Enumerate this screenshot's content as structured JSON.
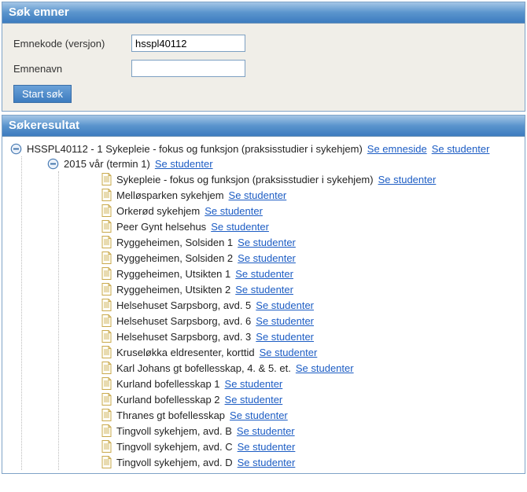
{
  "search_panel": {
    "title": "Søk emner",
    "label_code": "Emnekode (versjon)",
    "label_name": "Emnenavn",
    "value_code": "hsspl40112",
    "value_name": "",
    "button": "Start søk"
  },
  "results_panel": {
    "title": "Søkeresultat",
    "link_subjectpage": "Se emneside",
    "link_students": "Se studenter",
    "root": {
      "label": "HSSPL40112 - 1 Sykepleie - fokus og funksjon (praksisstudier i sykehjem)",
      "show_subjectpage": true,
      "show_students": true
    },
    "term": {
      "label": "2015 vår (termin 1)",
      "show_students": true
    },
    "leaves": [
      {
        "label": "Sykepleie - fokus og funksjon (praksisstudier i sykehjem)"
      },
      {
        "label": "Melløsparken sykehjem"
      },
      {
        "label": "Orkerød sykehjem"
      },
      {
        "label": "Peer Gynt helsehus"
      },
      {
        "label": "Ryggeheimen, Solsiden 1"
      },
      {
        "label": "Ryggeheimen, Solsiden 2"
      },
      {
        "label": "Ryggeheimen, Utsikten 1"
      },
      {
        "label": "Ryggeheimen, Utsikten 2"
      },
      {
        "label": "Helsehuset Sarpsborg, avd. 5"
      },
      {
        "label": "Helsehuset Sarpsborg, avd. 6"
      },
      {
        "label": "Helsehuset Sarpsborg, avd. 3"
      },
      {
        "label": "Kruseløkka eldresenter, korttid"
      },
      {
        "label": "Karl Johans gt bofellesskap, 4. & 5. et."
      },
      {
        "label": "Kurland bofellesskap 1"
      },
      {
        "label": "Kurland bofellesskap 2"
      },
      {
        "label": "Thranes gt bofellesskap"
      },
      {
        "label": "Tingvoll sykehjem, avd. B"
      },
      {
        "label": "Tingvoll sykehjem, avd. C"
      },
      {
        "label": "Tingvoll sykehjem, avd. D"
      }
    ]
  }
}
